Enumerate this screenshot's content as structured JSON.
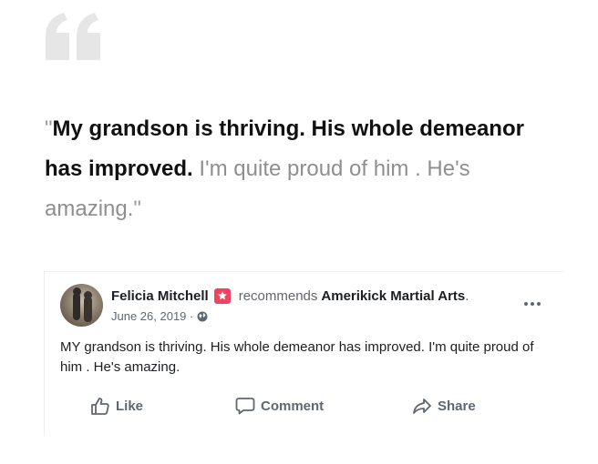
{
  "quote": {
    "open_quote": "\"",
    "bold_text": "My grandson is thriving. His whole demeanor has improved.",
    "light_text": " I'm quite proud of him . He's amazing.",
    "close_quote": "\""
  },
  "post": {
    "author": "Felicia Mitchell",
    "recommends_label": "recommends",
    "page_name": "Amerikick Martial Arts",
    "page_name_suffix": ".",
    "date": "June 26, 2019 ·",
    "body": "MY grandson is thriving. His whole demeanor has improved. I'm quite proud of him . He's amazing."
  },
  "actions": {
    "like": "Like",
    "comment": "Comment",
    "share": "Share"
  },
  "colors": {
    "badge": "#f3425f",
    "action_text": "#606770",
    "quote_icon": "#e6e6e6"
  }
}
